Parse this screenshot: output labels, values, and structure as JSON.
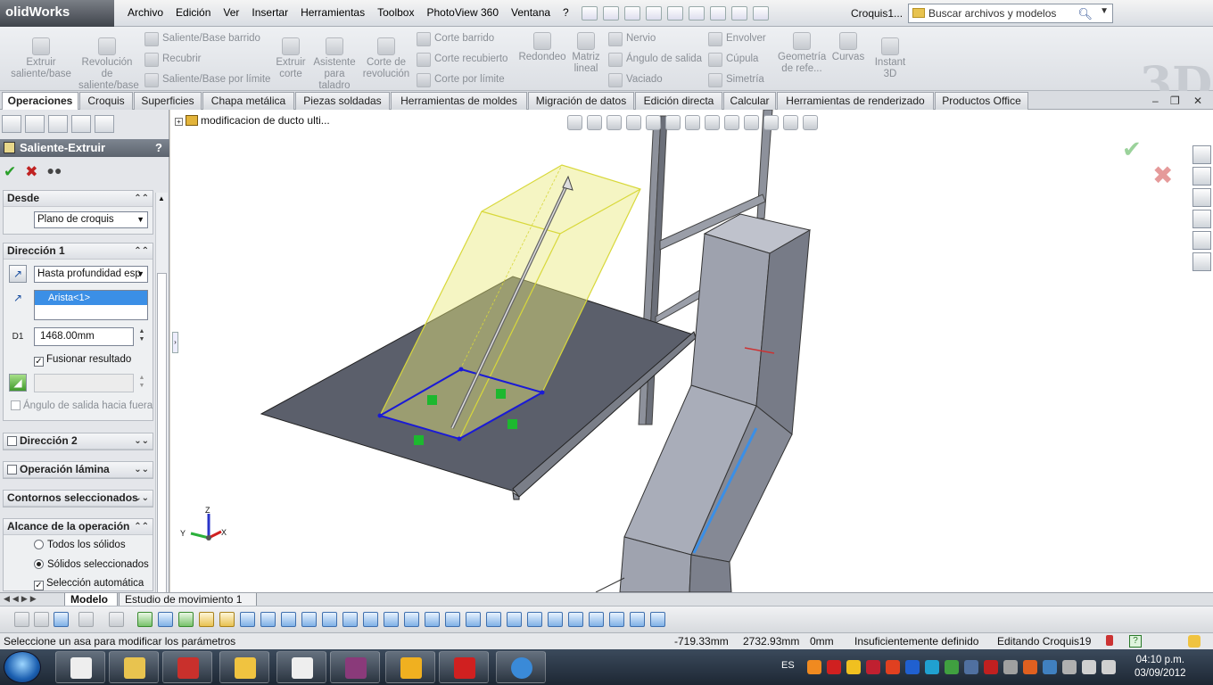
{
  "app": {
    "logo_text": "olidWorks",
    "document_title": "Croquis1..."
  },
  "menu": [
    "Archivo",
    "Edición",
    "Ver",
    "Insertar",
    "Herramientas",
    "Toolbox",
    "PhotoView 360",
    "Ventana",
    "?"
  ],
  "search": {
    "placeholder": "Buscar archivos y modelos"
  },
  "ribbon": {
    "extruir_saliente": "Extruir saliente/base",
    "revolucion": "Revolución de saliente/base",
    "saliente_barrido": "Saliente/Base barrido",
    "recubrir": "Recubrir",
    "saliente_limite": "Saliente/Base por límite",
    "extruir_corte": "Extruir corte",
    "asistente_taladro": "Asistente para taladro",
    "corte_revolucion": "Corte de revolución",
    "corte_barrido": "Corte barrido",
    "corte_recubierto": "Corte recubierto",
    "corte_limite": "Corte por límite",
    "redondeo": "Redondeo",
    "matriz_lineal": "Matriz lineal",
    "nervio": "Nervio",
    "angulo_salida": "Ángulo de salida",
    "vaciado": "Vaciado",
    "envolver": "Envolver",
    "cupula": "Cúpula",
    "simetria": "Simetría",
    "geometria_ref": "Geometría de refe...",
    "curvas": "Curvas",
    "instant3d": "Instant 3D"
  },
  "tabs": [
    "Operaciones",
    "Croquis",
    "Superficies",
    "Chapa metálica",
    "Piezas soldadas",
    "Herramientas de moldes",
    "Migración de datos",
    "Edición directa",
    "Calcular",
    "Herramientas de renderizado",
    "Productos Office"
  ],
  "property_manager": {
    "title": "Saliente-Extruir",
    "help": "?",
    "desde": {
      "header": "Desde",
      "value": "Plano de croquis"
    },
    "direccion1": {
      "header": "Dirección 1",
      "end_condition": "Hasta profundidad esp",
      "list_item": "Arista<1>",
      "depth": "1468.00mm",
      "fusionar": "Fusionar resultado",
      "angulo": "Ángulo de salida hacia fuera"
    },
    "direccion2": {
      "header": "Dirección 2"
    },
    "operacion_lamina": {
      "header": "Operación lámina"
    },
    "contornos": {
      "header": "Contornos seleccionados"
    },
    "alcance": {
      "header": "Alcance de la operación",
      "todos": "Todos los sólidos",
      "seleccionados": "Sólidos seleccionados",
      "automatica": "Selección automática"
    }
  },
  "viewport": {
    "tree_item": "modificacion de ducto ulti...",
    "axes": {
      "x": "X",
      "y": "Y",
      "z": "Z"
    }
  },
  "bottom_tabs": [
    "Modelo",
    "Estudio de movimiento 1"
  ],
  "status": {
    "message": "Seleccione un asa para modificar los parámetros",
    "x": "-719.33mm",
    "y": "2732.93mm",
    "z": "0mm",
    "definition": "Insuficientemente definido",
    "editing": "Editando Croquis19"
  },
  "taskbar": {
    "language": "ES",
    "time": "04:10 p.m.",
    "date": "03/09/2012"
  },
  "colors": {
    "accent": "#3b8fe6",
    "sketch_blue": "#1a1ad6",
    "preview_yellow": "#e8e87a",
    "model_gray": "#8f93a0"
  }
}
